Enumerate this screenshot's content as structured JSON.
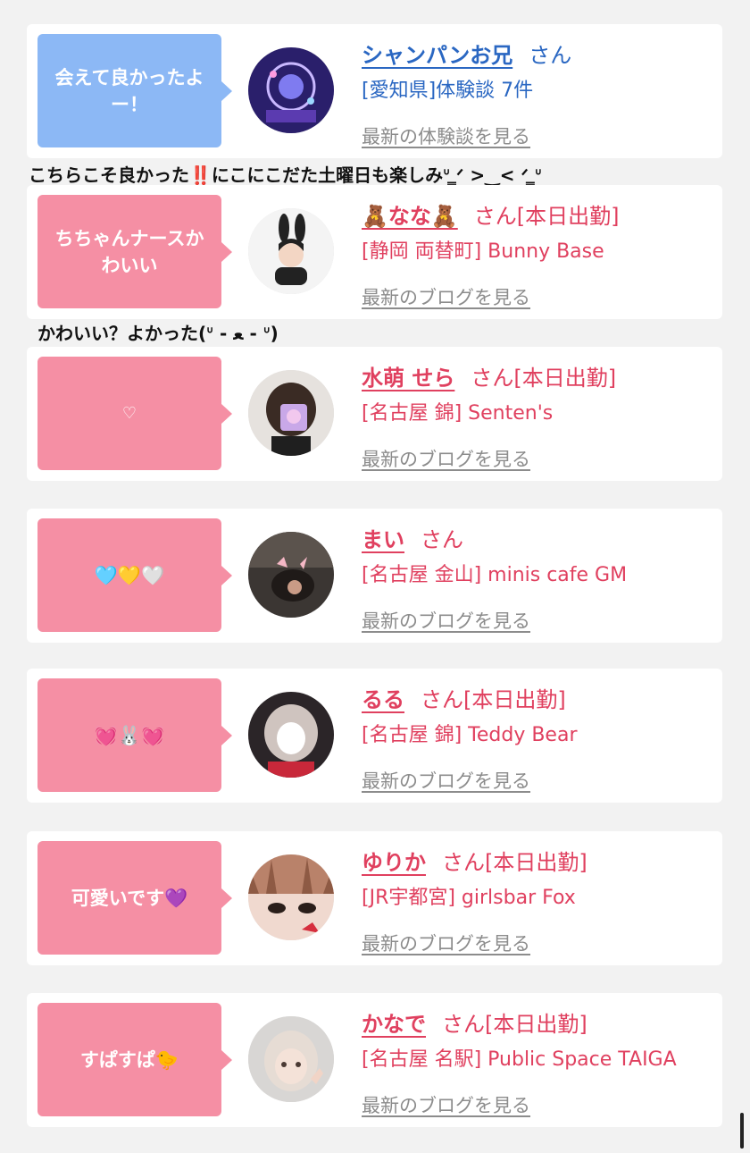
{
  "cards": [
    {
      "bubble": "会えて良かったよー！",
      "name": "シャンパンお兄",
      "suffix": "さん",
      "shop": "[愛知県]体験談 7件",
      "link": "最新の体験談を見る"
    },
    {
      "bubble": "ちちゃんナースかわいい",
      "name": "🧸なな🧸",
      "suffix": "さん[本日出勤]",
      "shop": "[静岡 両替町] Bunny Base",
      "link": "最新のブログを見る"
    },
    {
      "bubble": "♡",
      "name": "水萌 せら",
      "suffix": "さん[本日出勤]",
      "shop": "[名古屋 錦] Senten's",
      "link": "最新のブログを見る"
    },
    {
      "bubble": "🩵💛🤍",
      "name": "まい",
      "suffix": "さん",
      "shop": "[名古屋 金山] minis cafe GM",
      "link": "最新のブログを見る"
    },
    {
      "bubble": "💓🐰💓",
      "name": "るる",
      "suffix": "さん[本日出勤]",
      "shop": "[名古屋 錦] Teddy Bear",
      "link": "最新のブログを見る"
    },
    {
      "bubble": "可愛いです💜",
      "name": "ゆりか",
      "suffix": "さん[本日出勤]",
      "shop": "[JR宇都宮] girlsbar Fox",
      "link": "最新のブログを見る"
    },
    {
      "bubble": "すぱすぱ🐤",
      "name": "かなで",
      "suffix": "さん[本日出勤]",
      "shop": "[名古屋 名駅] Public Space TAIGA",
      "link": "最新のブログを見る"
    }
  ],
  "comments": [
    "こちらこそ良かった‼️にこにこだた土曜日も楽しみᐡ ̳ᐟ >‿< ᐟ ̳ᐡ",
    "かわいい？よかった(ᐡ - ﻌ - ᐡ)"
  ],
  "colors": {
    "pink": "#f58fa4",
    "blue": "#8cb8f5",
    "name_pink": "#e0405f",
    "name_blue": "#2a67c2"
  }
}
